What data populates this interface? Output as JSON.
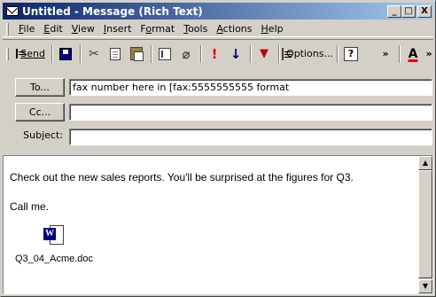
{
  "window": {
    "title": "Untitled - Message (Rich Text)",
    "controls": {
      "minimize": "_",
      "maximize": "□",
      "close": "X"
    }
  },
  "menubar": {
    "items": [
      {
        "label": "File",
        "accel": "F",
        "rest": "ile"
      },
      {
        "label": "Edit",
        "accel": "E",
        "rest": "dit"
      },
      {
        "label": "View",
        "accel": "V",
        "rest": "iew"
      },
      {
        "label": "Insert",
        "accel": "I",
        "rest": "nsert"
      },
      {
        "label": "Format",
        "pre": "F",
        "accel": "o",
        "rest": "rmat"
      },
      {
        "label": "Tools",
        "accel": "T",
        "rest": "ools"
      },
      {
        "label": "Actions",
        "accel": "A",
        "rest": "ctions"
      },
      {
        "label": "Help",
        "accel": "H",
        "rest": "elp"
      }
    ]
  },
  "toolbar": {
    "send_label": "Send",
    "options_label": "Options...",
    "help_label": "?",
    "more_label": "»",
    "font_color_label": "A"
  },
  "header": {
    "to_button": "To...",
    "to_value": "fax number here in [fax:5555555555 format",
    "cc_button": "Cc...",
    "cc_value": "",
    "subject_label": "Subject:",
    "subject_value": ""
  },
  "body": {
    "line1": "Check out the new sales reports. You'll be surprised at the figures for Q3.",
    "line2": "Call me.",
    "attachment_name": "Q3_04_Acme.doc"
  },
  "colors": {
    "titlebar_start": "#0a246a",
    "titlebar_end": "#a6caf0",
    "chrome": "#d4d0c8",
    "importance_high": "#e00000",
    "importance_low": "#000080"
  }
}
